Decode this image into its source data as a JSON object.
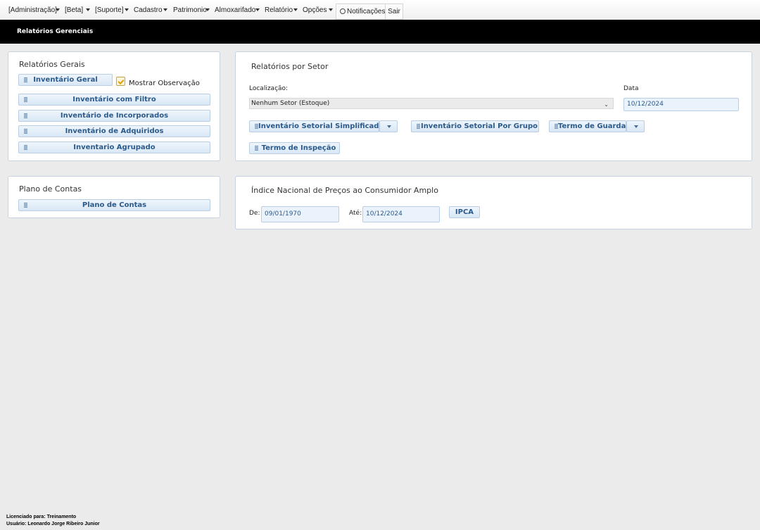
{
  "menu": {
    "items": [
      {
        "label": "[Administração]"
      },
      {
        "label": "[Beta]"
      },
      {
        "label": "[Suporte]"
      },
      {
        "label": "Cadastro"
      },
      {
        "label": "Patrimonio"
      },
      {
        "label": "Almoxarifado"
      },
      {
        "label": "Relatório"
      },
      {
        "label": "Opções"
      }
    ],
    "notifications_label": "Notificações",
    "exit_label": "Sair"
  },
  "header": {
    "title": "Relatórios Gerenciais"
  },
  "general_reports": {
    "title": "Relatórios Gerais",
    "general_inventory": "Inventário Geral",
    "show_notes_label": "Mostrar Observação",
    "show_notes_checked": true,
    "filtered_inventory": "Inventário com Filtro",
    "incorporated_inventory": "Inventário de Incorporados",
    "acquired_inventory": "Inventário de Adquiridos",
    "grouped_inventory": "Inventario Agrupado"
  },
  "sector_reports": {
    "title": "Relatórios por Setor",
    "location_label": "Localização:",
    "location_value": "Nenhum Setor (Estoque)",
    "date_label": "Data",
    "date_value": "10/12/2024",
    "simplified_sector_inventory": "Inventário Setorial Simplificado",
    "group_sector_inventory": "Inventário Setorial Por Grupo",
    "custody_term": "Termo de Guarda",
    "inspection_term": "Termo de Inspeção"
  },
  "chart_of_accounts": {
    "title": "Plano de Contas",
    "button": "Plano de Contas"
  },
  "ipca": {
    "title": "Índice Nacional de Preços ao Consumidor Amplo",
    "from_label": "De:",
    "from_value": "09/01/1970",
    "to_label": "Até:",
    "to_value": "10/12/2024",
    "button": "IPCA"
  },
  "footer": {
    "licensed_to": "Licenciado para: Treinamento",
    "user": "Usuário: Leonardo Jorge Ribeiro Junior"
  }
}
